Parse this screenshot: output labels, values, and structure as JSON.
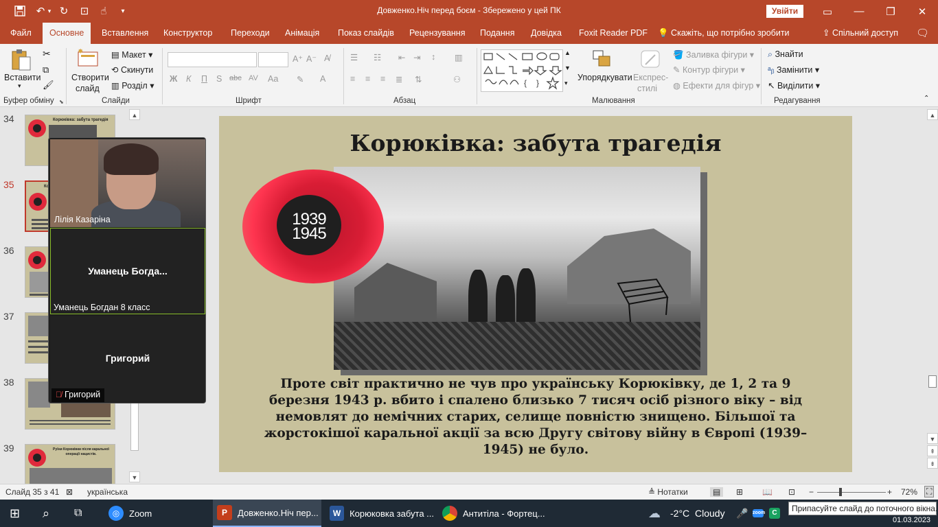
{
  "titlebar": {
    "title": "Довженко.Ніч перед боєм  -  Збережено у цей ПК",
    "signin": "Увійти",
    "icons": [
      "save-icon",
      "undo-icon",
      "redo-icon",
      "present-icon",
      "touch-icon",
      "customize-icon"
    ]
  },
  "tabs": [
    "Файл",
    "Основне",
    "Вставлення",
    "Конструктор",
    "Переходи",
    "Анімація",
    "Показ слайдів",
    "Рецензування",
    "Подання",
    "Довідка",
    "Foxit Reader PDF"
  ],
  "tellme": "Скажіть, що потрібно зробити",
  "share": "Спільний доступ",
  "ribbon": {
    "clipboard": {
      "paste": "Вставити",
      "label": "Буфер обміну"
    },
    "slides": {
      "new_slide_1": "Створити",
      "new_slide_2": "слайд",
      "layout": "Макет",
      "reset": "Скинути",
      "section": "Розділ",
      "label": "Слайди"
    },
    "font": {
      "bold": "Ж",
      "italic": "К",
      "underline": "П",
      "shadow": "S",
      "strike": "abc",
      "spacing": "AV",
      "case": "Aa",
      "label": "Шрифт"
    },
    "paragraph": {
      "label": "Абзац"
    },
    "drawing": {
      "arrange": "Упорядкувати",
      "quick_styles_1": "Експрес-",
      "quick_styles_2": "стилі",
      "fill": "Заливка фігури",
      "outline": "Контур фігури",
      "effects": "Ефекти для фігур",
      "label": "Малювання"
    },
    "editing": {
      "find": "Знайти",
      "replace": "Замінити",
      "select": "Виділити",
      "label": "Редагування"
    }
  },
  "thumbnails": [
    {
      "number": "34",
      "title": "Корюківка: забута трагедія"
    },
    {
      "number": "35",
      "title": "Корюківка"
    },
    {
      "number": "36",
      "title": ""
    },
    {
      "number": "37",
      "title": ""
    },
    {
      "number": "38",
      "title": ""
    },
    {
      "number": "39",
      "title": "Руїни Корюківки після каральної операції нацистів."
    }
  ],
  "zoom": {
    "participants": [
      {
        "tile_name": "",
        "label": "Лілія Казаріна",
        "has_video": true
      },
      {
        "tile_name": "Уманець  Богда...",
        "label": "Уманець Богдан 8 класс",
        "has_video": false
      },
      {
        "tile_name": "Григорий",
        "label": "Григорий",
        "has_video": false,
        "muted": true
      }
    ]
  },
  "slide": {
    "title": "Корюківка: забута трагедія",
    "years_top": "1939",
    "years_bottom": "1945",
    "text": "Проте світ практично не чув про українську Корюківку, де  1, 2 та 9 березня 1943 р. вбито і спалено близько 7 тисяч осіб різного віку – від немовлят до немічних старих, селище повністю знищено. Більшої та жорстокішої каральної акції за всю Другу світову війну в Європі (1939–1945) не було."
  },
  "statusbar": {
    "slide_info": "Слайд 35 з 41",
    "language": "українська",
    "notes": "Нотатки",
    "zoom": "72%"
  },
  "taskbar": {
    "apps": [
      {
        "label": "Zoom"
      },
      {
        "label": "Довженко.Ніч пер..."
      },
      {
        "label": "Корюковка забута ..."
      },
      {
        "label": "Антитіла - Фортец..."
      }
    ],
    "weather_temp": "-2°C",
    "weather_text": "Cloudy",
    "date": "01.03.2023"
  },
  "tooltip": "Припасуйте слайд до поточного вікна.",
  "colors": {
    "accent": "#b7472a",
    "slide_bg": "#c8c19c",
    "poppy": "#e02a3c",
    "taskbar": "#1f2a35"
  }
}
